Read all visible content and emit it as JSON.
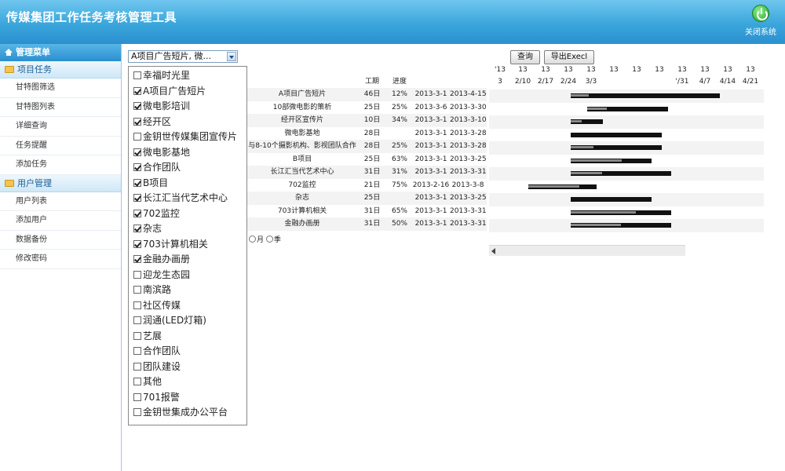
{
  "header": {
    "title": "传媒集团工作任务考核管理工具",
    "close_label": "关闭系统"
  },
  "sidebar": {
    "menu_title": "管理菜单",
    "groups": [
      {
        "label": "项目任务",
        "items": [
          "甘特图筛选",
          "甘特图列表",
          "详细查询",
          "任务提醒",
          "添加任务"
        ]
      },
      {
        "label": "用户管理",
        "items": [
          "用户列表",
          "添加用户",
          "数据备份",
          "修改密码"
        ]
      }
    ]
  },
  "toolbar": {
    "select_value": "A项目广告短片, 微...",
    "query_label": "查询",
    "export_label": "导出Execl"
  },
  "dropdown": {
    "options": [
      {
        "label": "幸福时光里",
        "checked": false
      },
      {
        "label": "A项目广告短片",
        "checked": true
      },
      {
        "label": "微电影培训",
        "checked": true
      },
      {
        "label": "经开区",
        "checked": true
      },
      {
        "label": "金钥世传媒集团宣传片",
        "checked": false
      },
      {
        "label": "微电影基地",
        "checked": true
      },
      {
        "label": "合作团队",
        "checked": true
      },
      {
        "label": "B项目",
        "checked": true
      },
      {
        "label": "长江汇当代艺术中心",
        "checked": true
      },
      {
        "label": "702监控",
        "checked": true
      },
      {
        "label": "杂志",
        "checked": true
      },
      {
        "label": "703计算机相关",
        "checked": true
      },
      {
        "label": "金融办画册",
        "checked": true
      },
      {
        "label": "迎龙生态园",
        "checked": false
      },
      {
        "label": "南滨路",
        "checked": false
      },
      {
        "label": "社区传媒",
        "checked": false
      },
      {
        "label": "润通(LED灯箱)",
        "checked": false
      },
      {
        "label": "艺展",
        "checked": false
      },
      {
        "label": "合作团队",
        "checked": false
      },
      {
        "label": "团队建设",
        "checked": false
      },
      {
        "label": "其他",
        "checked": false
      },
      {
        "label": "701报警",
        "checked": false
      },
      {
        "label": "金钥世集成办公平台",
        "checked": false
      }
    ]
  },
  "table": {
    "headers": {
      "duration": "工期",
      "progress": "进度"
    },
    "rows": [
      {
        "name": "A项目广告短片",
        "duration": "46日",
        "progress": "12%",
        "start": "2013-3-1",
        "end": "2013-4-15",
        "bar_start_day": 13,
        "bar_days": 46,
        "pct": 0.12
      },
      {
        "name": "10部微电影的策析",
        "duration": "25日",
        "progress": "25%",
        "start": "2013-3-6",
        "end": "2013-3-30",
        "bar_start_day": 18,
        "bar_days": 25,
        "pct": 0.25
      },
      {
        "name": "经开区宣传片",
        "duration": "10日",
        "progress": "34%",
        "start": "2013-3-1",
        "end": "2013-3-10",
        "bar_start_day": 13,
        "bar_days": 10,
        "pct": 0.34
      },
      {
        "name": "微电影基地",
        "duration": "28日",
        "progress": "",
        "start": "2013-3-1",
        "end": "2013-3-28",
        "bar_start_day": 13,
        "bar_days": 28,
        "pct": 0
      },
      {
        "name": "与8-10个摄影机构、影视团队合作",
        "duration": "28日",
        "progress": "25%",
        "start": "2013-3-1",
        "end": "2013-3-28",
        "bar_start_day": 13,
        "bar_days": 28,
        "pct": 0.25
      },
      {
        "name": "B项目",
        "duration": "25日",
        "progress": "63%",
        "start": "2013-3-1",
        "end": "2013-3-25",
        "bar_start_day": 13,
        "bar_days": 25,
        "pct": 0.63
      },
      {
        "name": "长江汇当代艺术中心",
        "duration": "31日",
        "progress": "31%",
        "start": "2013-3-1",
        "end": "2013-3-31",
        "bar_start_day": 13,
        "bar_days": 31,
        "pct": 0.31
      },
      {
        "name": "702监控",
        "duration": "21日",
        "progress": "75%",
        "start": "2013-2-16",
        "end": "2013-3-8",
        "bar_start_day": 0,
        "bar_days": 21,
        "pct": 0.75
      },
      {
        "name": "杂志",
        "duration": "25日",
        "progress": "",
        "start": "2013-3-1",
        "end": "2013-3-25",
        "bar_start_day": 13,
        "bar_days": 25,
        "pct": 0
      },
      {
        "name": "703计算机相关",
        "duration": "31日",
        "progress": "65%",
        "start": "2013-3-1",
        "end": "2013-3-31",
        "bar_start_day": 13,
        "bar_days": 31,
        "pct": 0.65
      },
      {
        "name": "金融办画册",
        "duration": "31日",
        "progress": "50%",
        "start": "2013-3-1",
        "end": "2013-3-31",
        "bar_start_day": 13,
        "bar_days": 31,
        "pct": 0.5
      }
    ]
  },
  "radios": {
    "month": "月",
    "season": "季"
  },
  "gantt": {
    "year_labels": [
      "'13",
      "13",
      "13",
      "13",
      "13",
      "13",
      "13",
      "13",
      "13",
      "13",
      "13",
      "13"
    ],
    "week_labels": [
      "3",
      "2/10",
      "2/17",
      "2/24",
      "3/3",
      "",
      "",
      "",
      "'/31",
      "4/7",
      "4/14",
      "4/21"
    ]
  }
}
